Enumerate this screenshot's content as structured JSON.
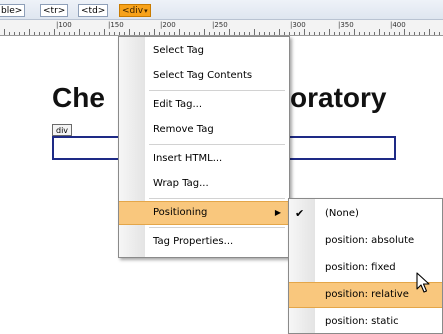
{
  "tag_selector": {
    "tags": [
      "ble>",
      "<tr>",
      "<td>"
    ],
    "active_tag": "<div",
    "active_caret": "▾"
  },
  "ruler": {
    "numbers": [
      "|100",
      "|150",
      "|200",
      "|250",
      "|300",
      "|350",
      "|400"
    ]
  },
  "document": {
    "heading_left": "Che",
    "heading_right": "oratory",
    "div_label": "div"
  },
  "context_menu": {
    "items": [
      "Select Tag",
      "Select Tag Contents",
      "Edit Tag...",
      "Remove Tag",
      "Insert HTML...",
      "Wrap Tag...",
      "Positioning",
      "Tag Properties..."
    ],
    "highlighted": "Positioning",
    "submenu_arrow": "▶"
  },
  "positioning_submenu": {
    "items": [
      "(None)",
      "position: absolute",
      "position: fixed",
      "position: relative",
      "position: static"
    ],
    "checked": "(None)",
    "highlighted": "position: relative",
    "check_mark": "✔"
  },
  "colors": {
    "active_tag": "#f7a21b",
    "menu_highlight": "#f9c77d",
    "div_border": "#1e2a86"
  }
}
